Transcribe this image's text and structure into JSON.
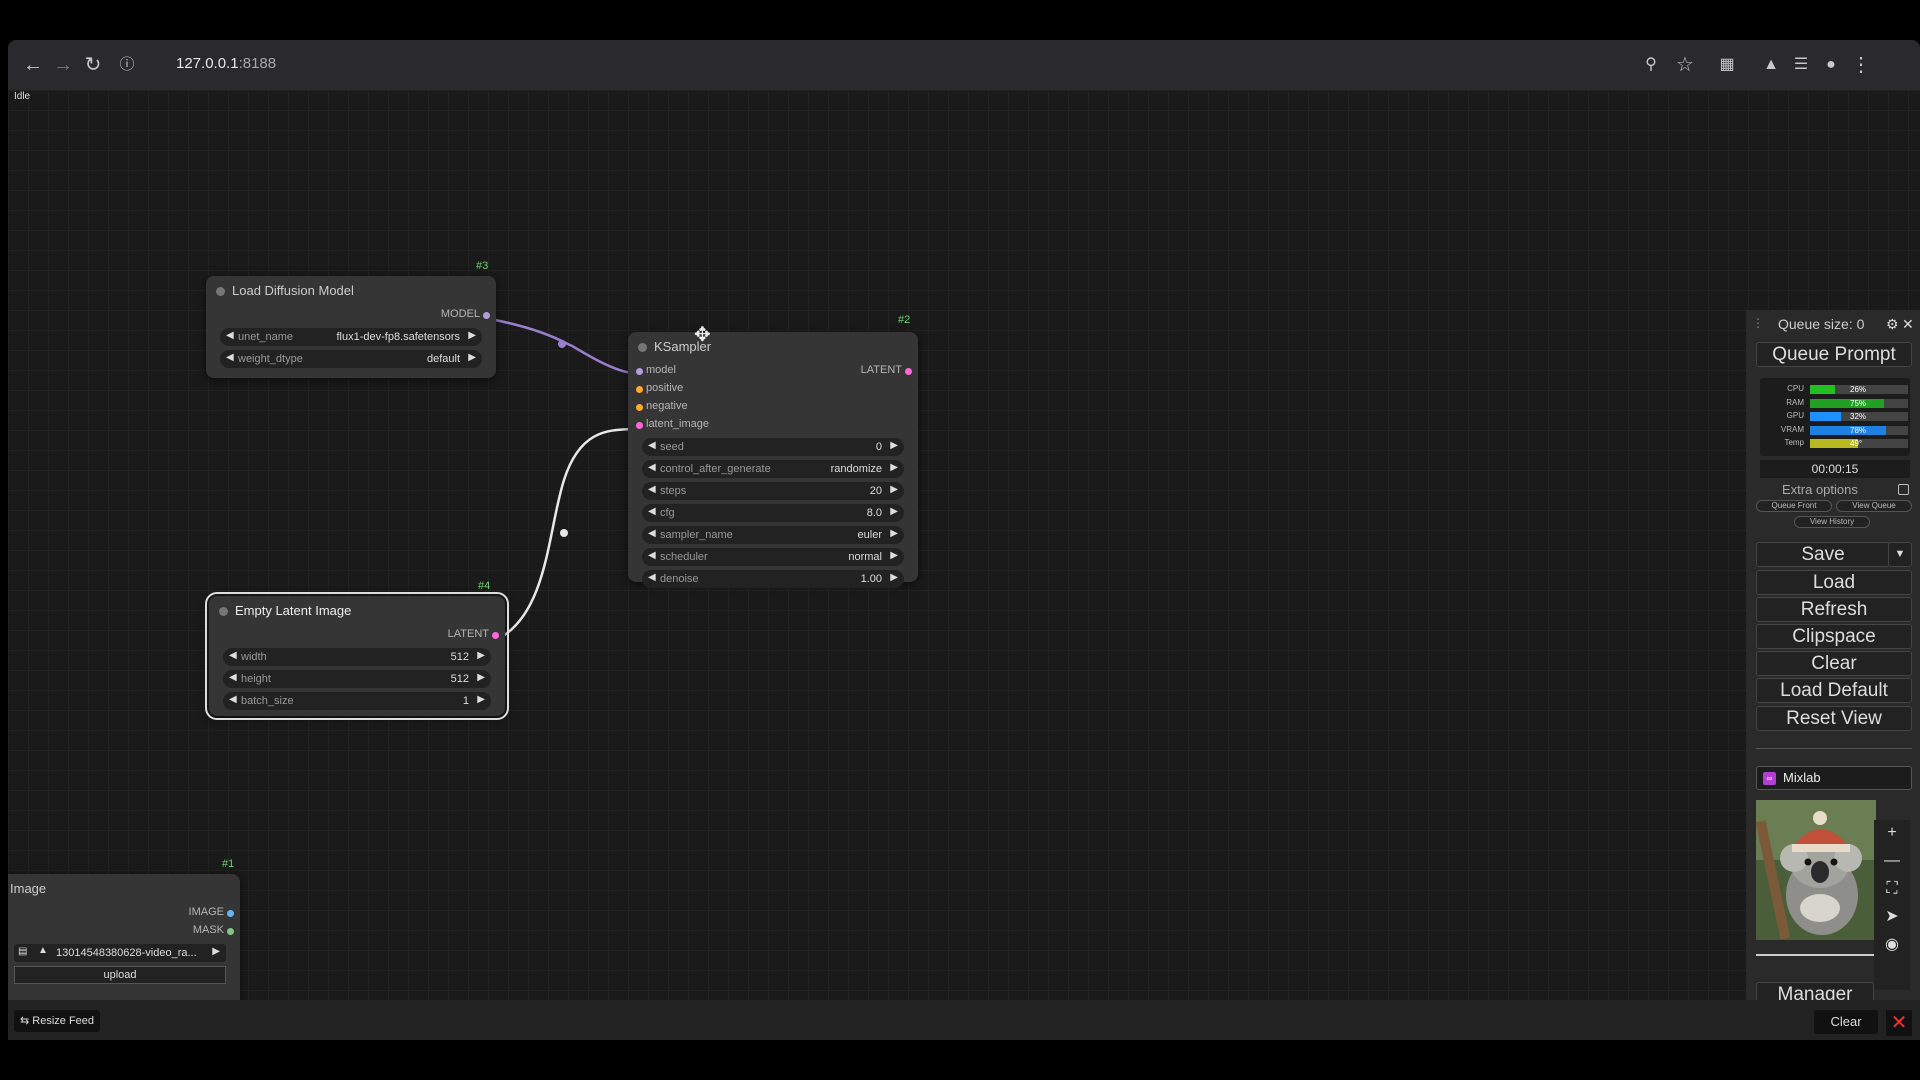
{
  "browser": {
    "url_host": "127.0.0.1",
    "url_port": ":8188"
  },
  "status": "Idle",
  "nodes": {
    "load_diffusion": {
      "id": "#3",
      "title": "Load Diffusion Model",
      "output": "MODEL",
      "widgets": [
        {
          "label": "unet_name",
          "value": "flux1-dev-fp8.safetensors"
        },
        {
          "label": "weight_dtype",
          "value": "default"
        }
      ]
    },
    "ksampler": {
      "id": "#2",
      "title": "KSampler",
      "inputs": [
        "model",
        "positive",
        "negative",
        "latent_image"
      ],
      "output": "LATENT",
      "widgets": [
        {
          "label": "seed",
          "value": "0"
        },
        {
          "label": "control_after_generate",
          "value": "randomize"
        },
        {
          "label": "steps",
          "value": "20"
        },
        {
          "label": "cfg",
          "value": "8.0"
        },
        {
          "label": "sampler_name",
          "value": "euler"
        },
        {
          "label": "scheduler",
          "value": "normal"
        },
        {
          "label": "denoise",
          "value": "1.00"
        }
      ]
    },
    "empty_latent": {
      "id": "#4",
      "title": "Empty Latent Image",
      "output": "LATENT",
      "widgets": [
        {
          "label": "width",
          "value": "512"
        },
        {
          "label": "height",
          "value": "512"
        },
        {
          "label": "batch_size",
          "value": "1"
        }
      ]
    },
    "load_image": {
      "id": "#1",
      "title": "Image",
      "outputs": [
        "IMAGE",
        "MASK"
      ],
      "file": "13014548380628-video_ra...",
      "upload_label": "upload"
    }
  },
  "side_panel": {
    "queue_size": "Queue size: 0",
    "queue_prompt": "Queue Prompt",
    "monitor": [
      {
        "label": "CPU",
        "value": "26%",
        "level": 0.26,
        "color": "#22c022"
      },
      {
        "label": "RAM",
        "value": "75%",
        "level": 0.75,
        "color": "#22a022"
      },
      {
        "label": "GPU",
        "value": "32%",
        "level": 0.32,
        "color": "#1e90ff"
      },
      {
        "label": "VRAM",
        "value": "78%",
        "level": 0.78,
        "color": "#1e80e0"
      },
      {
        "label": "Temp",
        "value": "49°",
        "level": 0.49,
        "color": "#b8b820"
      }
    ],
    "timer": "00:00:15",
    "extra_options": "Extra options",
    "queue_front": "Queue Front",
    "view_queue": "View Queue",
    "view_history": "View History",
    "save": "Save",
    "load": "Load",
    "refresh": "Refresh",
    "clipspace": "Clipspace",
    "clear": "Clear",
    "load_default": "Load Default",
    "reset_view": "Reset View",
    "mixlab": "Mixlab",
    "manager": "Manager"
  },
  "bottom_bar": {
    "resize_feed": "Resize Feed",
    "clear": "Clear"
  },
  "colors": {
    "model_link": "#9a7fd0",
    "latent_link": "#e8e8e8",
    "latent_slot": "#ff6bd6",
    "model_slot": "#b39ddb",
    "conditioning_slot": "#ffa931",
    "image_slot": "#64b5f6",
    "mask_slot": "#81c784"
  }
}
